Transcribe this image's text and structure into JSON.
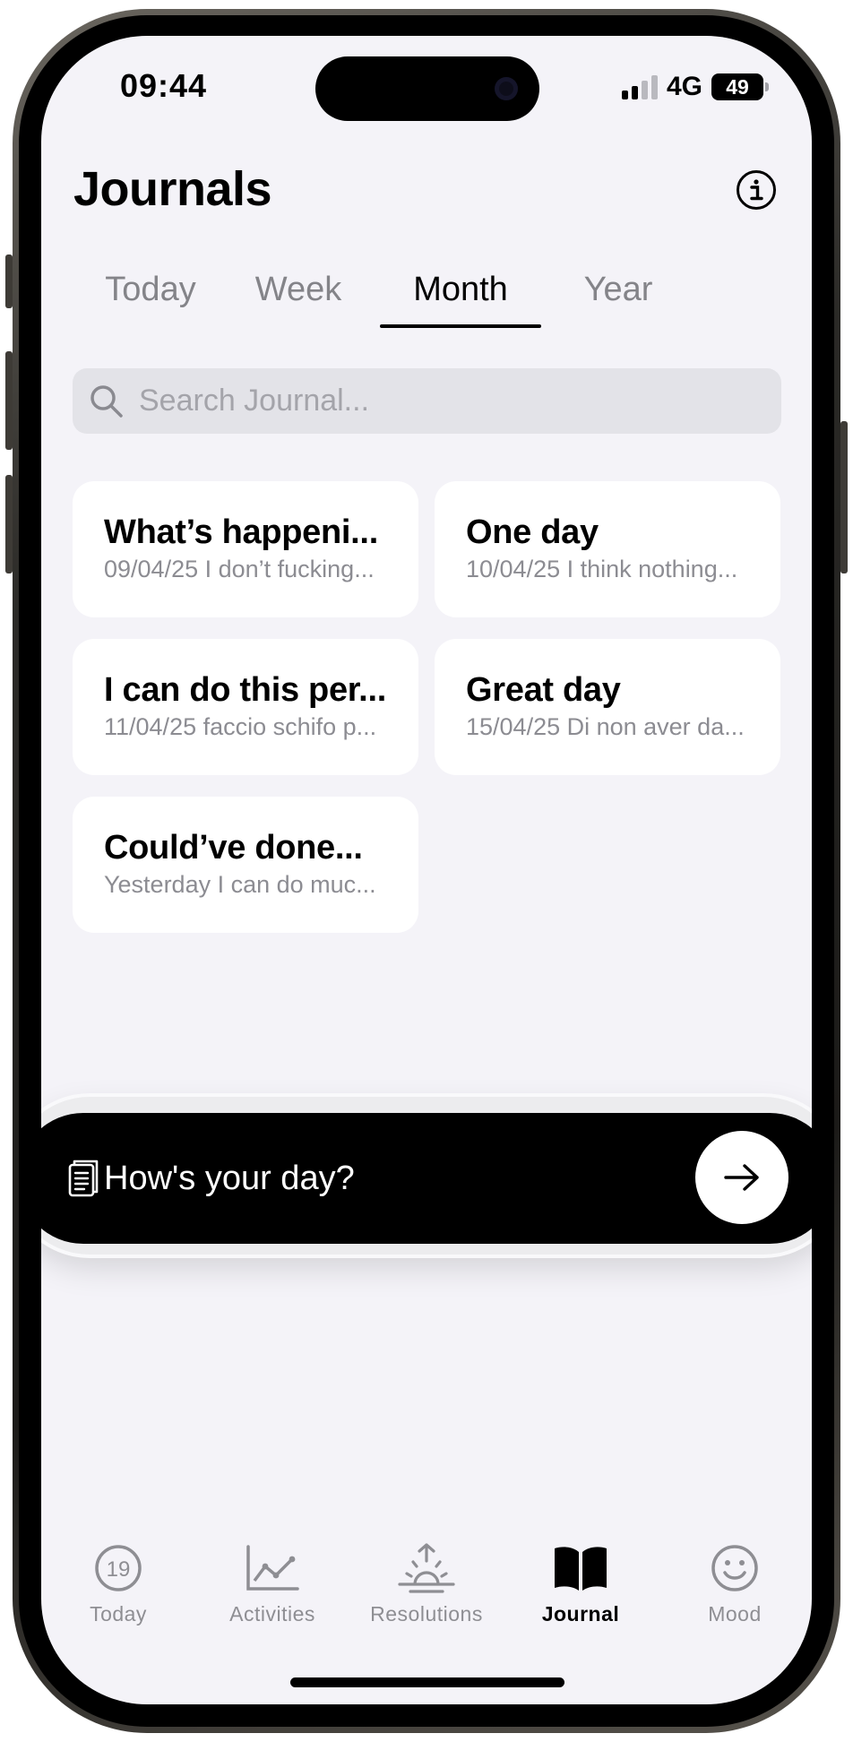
{
  "status_bar": {
    "time": "09:44",
    "network": "4G",
    "battery": "49"
  },
  "header": {
    "title": "Journals",
    "info_icon": "info-circle-icon"
  },
  "tabs": [
    {
      "label": "Today",
      "active": false
    },
    {
      "label": "Week",
      "active": false
    },
    {
      "label": "Month",
      "active": true
    },
    {
      "label": "Year",
      "active": false
    }
  ],
  "search": {
    "placeholder": "Search Journal...",
    "value": ""
  },
  "entries": [
    {
      "title": "What’s happeni...",
      "preview": "09/04/25 I don’t fucking..."
    },
    {
      "title": "One day",
      "preview": "10/04/25 I think nothing..."
    },
    {
      "title": "I can do this per...",
      "preview": "11/04/25 faccio schifo p..."
    },
    {
      "title": "Great day",
      "preview": "15/04/25 Di non aver da..."
    },
    {
      "title": "Could’ve done...",
      "preview": "Yesterday I can do muc..."
    }
  ],
  "composer": {
    "placeholder": "How's your day?",
    "icon": "notebook-icon",
    "send_icon": "arrow-right-icon"
  },
  "tabbar": [
    {
      "label": "Today",
      "icon": "calendar-day-icon",
      "badge": "19",
      "active": false
    },
    {
      "label": "Activities",
      "icon": "chart-line-icon",
      "active": false
    },
    {
      "label": "Resolutions",
      "icon": "sunrise-icon",
      "active": false
    },
    {
      "label": "Journal",
      "icon": "book-open-icon",
      "active": true
    },
    {
      "label": "Mood",
      "icon": "smiley-icon",
      "active": false
    }
  ],
  "colors": {
    "background": "#f4f3f8",
    "accent": "#000000",
    "muted": "#8e8e93"
  }
}
